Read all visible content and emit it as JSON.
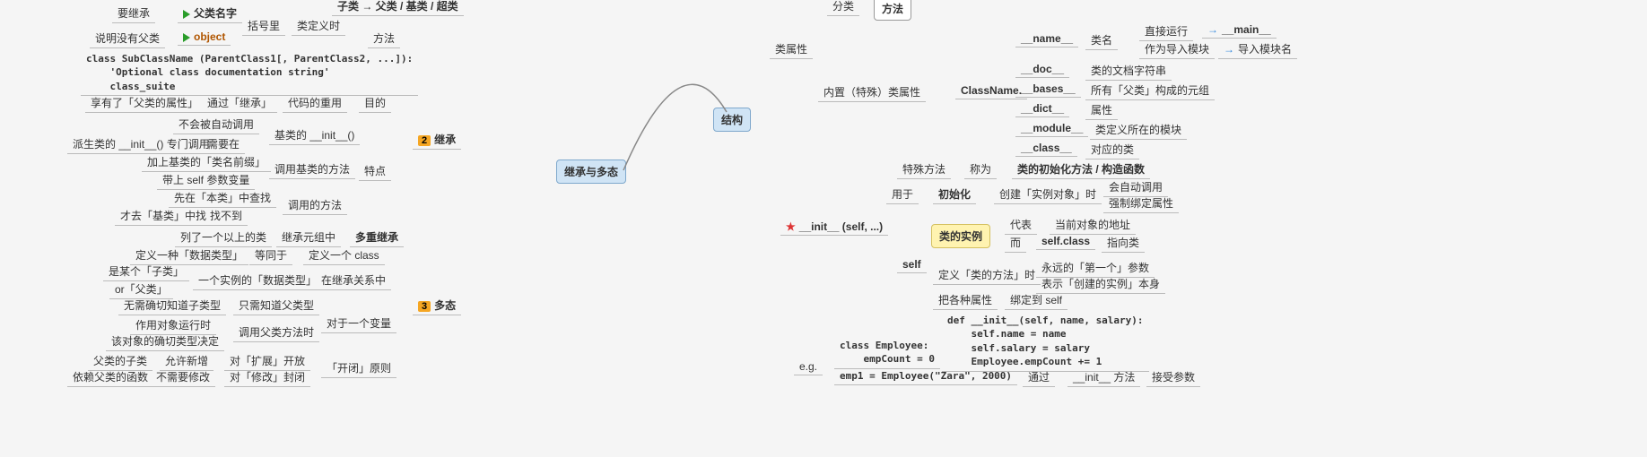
{
  "central_left": "继承与多态",
  "central_right": "结构",
  "inherit": {
    "label": "继承",
    "badge": "2",
    "topline": "子类 → 父类 / 基类 / 超类",
    "parent_name": "父类名字",
    "want_inherit": "要继承",
    "object": "object",
    "no_parent": "说明没有父类",
    "bracket": "括号里",
    "def_time": "类定义时",
    "method": "方法",
    "code": "class SubClassName (ParentClass1[, ParentClass2, ...]):\n    'Optional class documentation string'\n    class_suite",
    "purpose": "目的",
    "code_reuse": "代码的重用",
    "through_inherit": "通过「继承」",
    "has_parent_attr": "享有了「父类的属性」",
    "features": "特点",
    "base_init": "基类的 __init__()",
    "not_auto": "不会被自动调用",
    "need_in": "需要在",
    "derived_init": "派生类的 __init__() 专门调用",
    "call_base_method": "调用基类的方法",
    "add_prefix": "加上基类的「类名前缀」",
    "with_self": "带上 self 参数变量",
    "call_method": "调用的方法",
    "search_self": "先在「本类」中查找",
    "not_found": "找不到",
    "search_base": "才去「基类」中找",
    "multi_inherit": "多重继承",
    "inherit_tuple": "继承元组中",
    "list_multi": "列了一个以上的类"
  },
  "poly": {
    "label": "多态",
    "badge": "3",
    "def_class": "定义一个 class",
    "equiv": "等同于",
    "def_type": "定义一种「数据类型」",
    "in_inherit": "在继承关系中",
    "instance_type": "一个实例的「数据类型」",
    "is_sub": "是某个「子类」",
    "or_parent": "or「父类」",
    "one_var": "对于一个变量",
    "only_parent": "只需知道父类型",
    "no_exact": "无需确切知道子类型",
    "call_parent": "调用父类方法时",
    "runtime": "作用对象运行时",
    "exact_type": "该对象的确切类型决定",
    "open_close": "「开闭」原则",
    "open_ext": "对「扩展」开放",
    "allow_new": "允许新增",
    "parent_sub": "父类的子类",
    "close_mod": "对「修改」封闭",
    "no_modify": "不需要修改",
    "depend_func": "依赖父类的函数"
  },
  "struct": {
    "class_attr": "类属性",
    "category": "分类",
    "method": "方法",
    "builtin_attr": "内置（特殊）类属性",
    "classname_dot": "ClassName.",
    "name_attr": "__name__",
    "name_desc": "类名",
    "direct_run": "直接运行",
    "main": "__main__",
    "as_module": "作为导入模块",
    "module_name": "导入模块名",
    "doc_attr": "__doc__",
    "doc_desc": "类的文档字符串",
    "bases_attr": "__bases__",
    "bases_desc": "所有「父类」构成的元组",
    "dict_attr": "__dict__",
    "dict_desc": "属性",
    "module_attr": "__module__",
    "module_desc": "类定义所在的模块",
    "class_attr2": "__class__",
    "class_desc": "对应的类"
  },
  "init": {
    "label": "__init__ (self, ...)",
    "special": "特殊方法",
    "called": "称为",
    "init_method": "类的初始化方法 / 构造函数",
    "used_for": "用于",
    "initialize": "初始化",
    "create_instance": "创建「实例对象」时",
    "auto_call": "会自动调用",
    "force_bind": "强制绑定属性",
    "self": "self",
    "class_instance": "类的实例",
    "represents": "代表",
    "current_addr": "当前对象的地址",
    "while": "而",
    "self_class2": "self.class",
    "points_to": "指向类",
    "def_method": "定义「类的方法」时",
    "always_first": "永远的「第一个」参数",
    "repr_instance": "表示「创建的实例」本身",
    "bind_attrs": "把各种属性",
    "bind_to_self": "绑定到 self",
    "eg": "e.g.",
    "code1": "class Employee:\n    empCount = 0",
    "code2": "def __init__(self, name, salary):\n    self.name = name\n    self.salary = salary\n    Employee.empCount += 1",
    "code3": "emp1 = Employee(\"Zara\", 2000)",
    "through": "通过",
    "init_method2": "__init__ 方法",
    "accept_args": "接受参数"
  }
}
